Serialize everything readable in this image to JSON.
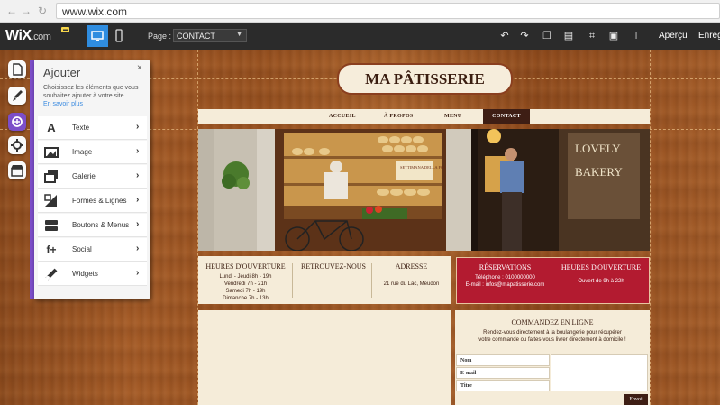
{
  "browser": {
    "url": "www.wix.com"
  },
  "editor": {
    "logo": "WiX",
    "logo_domain": ".com",
    "page_label": "Page :",
    "page_value": "CONTACT",
    "preview_label": "Aperçu",
    "save_label": "Enreg"
  },
  "add_panel": {
    "title": "Ajouter",
    "close": "×",
    "description": "Choisissez les éléments que vous souhaitez ajouter à votre site.",
    "learn_more": "En savoir plus",
    "items": [
      {
        "label": "Texte",
        "icon": "text-icon"
      },
      {
        "label": "Image",
        "icon": "image-icon"
      },
      {
        "label": "Galerie",
        "icon": "gallery-icon"
      },
      {
        "label": "Formes & Lignes",
        "icon": "shapes-icon"
      },
      {
        "label": "Boutons & Menus",
        "icon": "buttons-menus-icon"
      },
      {
        "label": "Social",
        "icon": "social-icon"
      },
      {
        "label": "Widgets",
        "icon": "widgets-icon"
      }
    ]
  },
  "site": {
    "logo_title": "MA PÂTISSERIE",
    "menu": [
      "ACCUEIL",
      "À PROPOS",
      "MENU",
      "CONTACT"
    ],
    "active_menu": "CONTACT",
    "photo_signs": {
      "left_store": "SETTIMANA DELLA FOCACCIA",
      "right_store_1": "LOVELY",
      "right_store_2": "BAKERY"
    },
    "hours": {
      "title": "HEURES D'OUVERTURE",
      "lines": [
        "Lundi - Jeudi 8h - 19h",
        "Vendredi 7h - 21h",
        "Samedi 7h - 19h",
        "Dimanche 7h - 13h"
      ]
    },
    "social": {
      "title": "RETROUVEZ-NOUS"
    },
    "address": {
      "title": "ADRESSE",
      "text": "21 rue du Lac, Meudon"
    },
    "reservations": {
      "title": "RÉSERVATIONS",
      "phone": "Téléphone : 0100000000",
      "email": "E-mail : infos@mapatisserie.com"
    },
    "hours_red": {
      "title": "HEURES D'OUVERTURE",
      "text": "Ouvert de 9h à 22h"
    },
    "order": {
      "title": "COMMANDEZ EN LIGNE",
      "desc1": "Rendez-vous directement à la boulangerie pour récupérer",
      "desc2": "votre commande ou faites-vous livrer directement à domicile !",
      "fields": [
        "Nom",
        "E-mail",
        "Titre"
      ],
      "send": "Envoi"
    }
  }
}
